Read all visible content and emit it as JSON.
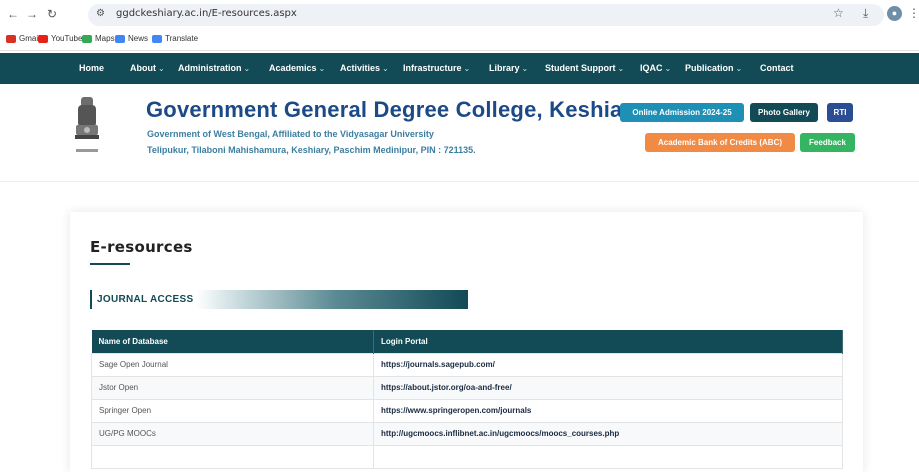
{
  "browser": {
    "url": "ggdckeshiary.ac.in/E-resources.aspx",
    "bookmarks": [
      {
        "label": "Gmail",
        "icon": "gmail-icon",
        "color": "#d93025"
      },
      {
        "label": "YouTube",
        "icon": "youtube-icon",
        "color": "#e62117"
      },
      {
        "label": "Maps",
        "icon": "maps-icon",
        "color": "#34a853"
      },
      {
        "label": "News",
        "icon": "news-icon",
        "color": "#4285f4"
      },
      {
        "label": "Translate",
        "icon": "translate-icon",
        "color": "#4285f4"
      }
    ]
  },
  "nav": {
    "items": [
      "Home",
      "About",
      "Administration",
      "Academics",
      "Activities",
      "Infrastructure",
      "Library",
      "Student Support",
      "IQAC",
      "Publication",
      "Contact"
    ],
    "color": "#124a55"
  },
  "header": {
    "title": "Government General Degree College, Keshiary",
    "sub1": "Government of West Bengal, Affiliated to the Vidyasagar University",
    "sub2": "Telipukur, Tilaboni Mahishamura, Keshiary, Paschim Medinipur, PIN : 721135.",
    "buttons": {
      "admission": "Online Admission 2024-25",
      "gallery": "Photo Gallery",
      "rti": "RTI",
      "abc": "Academic Bank of Credits (ABC)",
      "feedback": "Feedback"
    }
  },
  "content": {
    "heading": "E-resources",
    "section": "JOURNAL ACCESS",
    "table": {
      "headers": [
        "Name of Database",
        "Login Portal"
      ],
      "rows": [
        [
          "Sage Open Journal",
          "https://journals.sagepub.com/"
        ],
        [
          "Jstor Open",
          "https://about.jstor.org/oa-and-free/"
        ],
        [
          "Springer Open",
          "https://www.springeropen.com/journals"
        ],
        [
          "UG/PG MOOCs",
          "http://ugcmoocs.inflibnet.ac.in/ugcmoocs/moocs_courses.php"
        ],
        [
          "",
          ""
        ]
      ]
    }
  }
}
